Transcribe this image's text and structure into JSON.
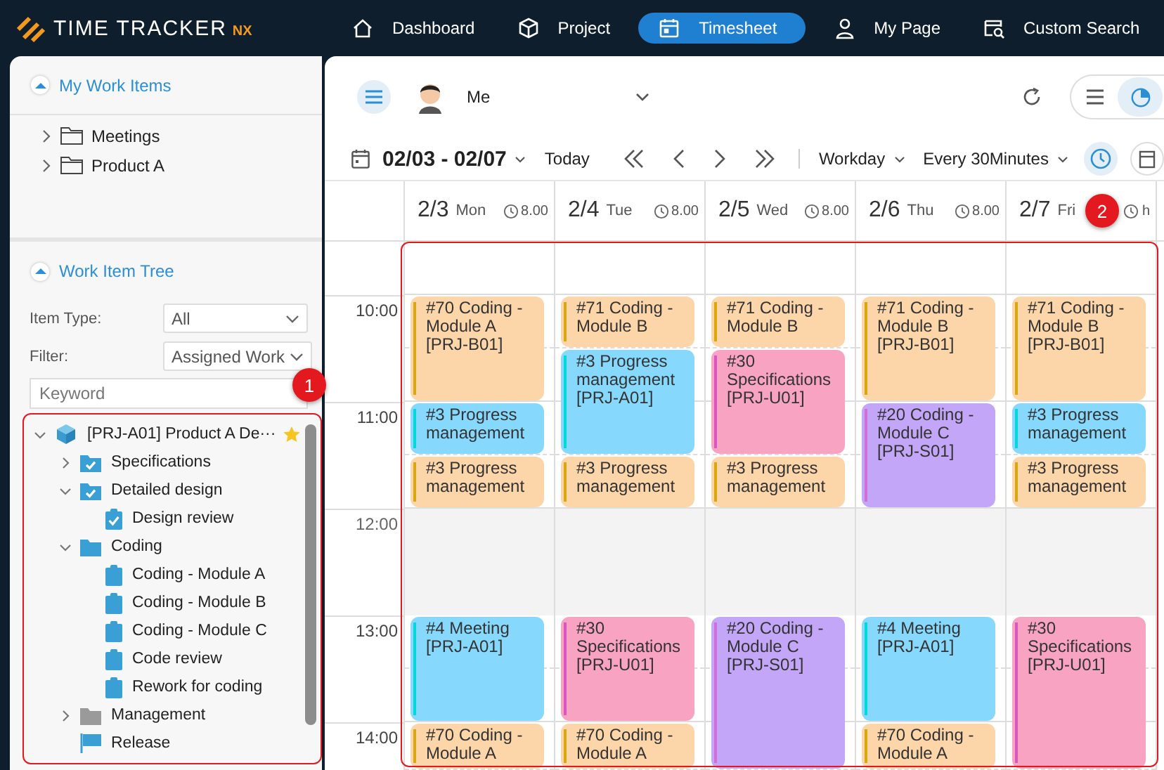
{
  "header": {
    "logo": {
      "main": "TIME TRACKER",
      "suffix": "NX"
    },
    "nav": [
      {
        "label": "Dashboard",
        "selected": false
      },
      {
        "label": "Project",
        "selected": false
      },
      {
        "label": "Timesheet",
        "selected": true
      },
      {
        "label": "My Page",
        "selected": false
      },
      {
        "label": "Custom Search",
        "selected": false
      }
    ]
  },
  "sidebar": {
    "my_work_items": {
      "title": "My Work Items",
      "expanded": true,
      "items": [
        {
          "label": "Meetings",
          "expanded": false
        },
        {
          "label": "Product A",
          "expanded": false
        }
      ]
    },
    "work_item_tree": {
      "title": "Work Item Tree",
      "expanded": true,
      "filters": [
        {
          "label": "Item Type:",
          "value": "All"
        },
        {
          "label": "Filter:",
          "value": "Assigned Work"
        }
      ],
      "search": {
        "placeholder": "Keyword"
      },
      "badge": "1",
      "items": [
        {
          "label": "[PRJ-A01] Product A De···",
          "kind": "project",
          "expanded": true,
          "starred": true,
          "children": [
            {
              "label": "Specifications",
              "kind": "folder",
              "completed": true,
              "expanded": false
            },
            {
              "label": "Detailed design",
              "kind": "folder",
              "completed": true,
              "expanded": true,
              "children": [
                {
                  "label": "Design review",
                  "kind": "task",
                  "completed": true
                }
              ]
            },
            {
              "label": "Coding",
              "kind": "folder",
              "completed": false,
              "expanded": true,
              "children": [
                {
                  "label": "Coding - Module A",
                  "kind": "task",
                  "completed": false
                },
                {
                  "label": "Coding - Module B",
                  "kind": "task",
                  "completed": false
                },
                {
                  "label": "Coding - Module C",
                  "kind": "task",
                  "completed": false
                },
                {
                  "label": "Code review",
                  "kind": "task",
                  "completed": false
                },
                {
                  "label": "Rework for coding",
                  "kind": "task",
                  "completed": false
                }
              ]
            },
            {
              "label": "Management",
              "kind": "category",
              "expanded": false
            },
            {
              "label": "Release",
              "kind": "milestone"
            }
          ]
        }
      ]
    }
  },
  "toolbar": {
    "user": "Me",
    "view_modes": [
      {
        "selected": false
      },
      {
        "selected": true
      }
    ],
    "date_range": "02/03 - 02/07",
    "today": "Today",
    "day_filter": "Workday",
    "interval": "Every 30Minutes",
    "show_hours": true
  },
  "calendar": {
    "badge": "2",
    "times": [
      {
        "label": "10:00",
        "break": false
      },
      {
        "label": "11:00",
        "break": false
      },
      {
        "label": "12:00",
        "break": true
      },
      {
        "label": "13:00",
        "break": false
      },
      {
        "label": "14:00",
        "break": false
      }
    ],
    "days": [
      {
        "date": "2/3",
        "weekday": "Mon",
        "hours": "8.00",
        "morning": [
          {
            "title": "#70 Coding - Module A",
            "code": "[PRJ-B01]",
            "kind": "hour",
            "color": "#fcd5a8"
          },
          {
            "title": "#3 Progress management",
            "kind": "half",
            "color": "#87d8fd"
          },
          {
            "title": "#3 Progress management",
            "kind": "half",
            "color": "#fcd5a8"
          }
        ],
        "afternoon": [
          {
            "title": "#4 Meeting",
            "code": "[PRJ-A01]",
            "kind": "hour",
            "color": "#87d8fd"
          },
          {
            "title": "#70 Coding - Module A",
            "kind": "half",
            "color": "#fcd5a8"
          }
        ]
      },
      {
        "date": "2/4",
        "weekday": "Tue",
        "hours": "8.00",
        "morning": [
          {
            "title": "#71 Coding - Module B",
            "kind": "half",
            "color": "#fcd5a8"
          },
          {
            "title": "#3 Progress management",
            "code": "[PRJ-A01]",
            "kind": "hour",
            "color": "#87d8fd"
          },
          {
            "title": "#3 Progress management",
            "kind": "half",
            "color": "#fcd5a8"
          }
        ],
        "afternoon": [
          {
            "title": "#30 Specifications",
            "code": "[PRJ-U01]",
            "kind": "hour",
            "color": "#f9a3c3"
          },
          {
            "title": "#70 Coding - Module A",
            "kind": "half",
            "color": "#fcd5a8"
          }
        ]
      },
      {
        "date": "2/5",
        "weekday": "Wed",
        "hours": "8.00",
        "morning": [
          {
            "title": "#71 Coding - Module B",
            "kind": "half",
            "color": "#fcd5a8"
          },
          {
            "title": "#30 Specifications",
            "code": "[PRJ-U01]",
            "kind": "hour",
            "color": "#f9a3c3"
          },
          {
            "title": "#3 Progress management",
            "kind": "half",
            "color": "#fcd5a8"
          }
        ],
        "afternoon": [
          {
            "title": "#20 Coding - Module C",
            "code": "[PRJ-S01]",
            "kind": "long",
            "color": "#c3a6f8"
          }
        ]
      },
      {
        "date": "2/6",
        "weekday": "Thu",
        "hours": "8.00",
        "morning": [
          {
            "title": "#71 Coding - Module B",
            "code": "[PRJ-B01]",
            "kind": "hour",
            "color": "#fcd5a8"
          },
          {
            "title": "#20 Coding - Module C",
            "code": "[PRJ-S01]",
            "kind": "hour",
            "color": "#c3a6f8"
          }
        ],
        "afternoon": [
          {
            "title": "#4 Meeting",
            "code": "[PRJ-A01]",
            "kind": "hour",
            "color": "#87d8fd"
          },
          {
            "title": "#70 Coding - Module A",
            "kind": "half",
            "color": "#fcd5a8"
          }
        ]
      },
      {
        "date": "2/7",
        "weekday": "Fri",
        "hours": "h",
        "morning": [
          {
            "title": "#71 Coding - Module B",
            "code": "[PRJ-B01]",
            "kind": "hour",
            "color": "#fcd5a8"
          },
          {
            "title": "#3 Progress management",
            "kind": "half",
            "color": "#87d8fd"
          },
          {
            "title": "#3 Progress management",
            "kind": "half",
            "color": "#fcd5a8"
          }
        ],
        "afternoon": [
          {
            "title": "#30 Specifications",
            "code": "[PRJ-U01]",
            "kind": "long",
            "color": "#f9a3c3"
          }
        ]
      }
    ]
  }
}
